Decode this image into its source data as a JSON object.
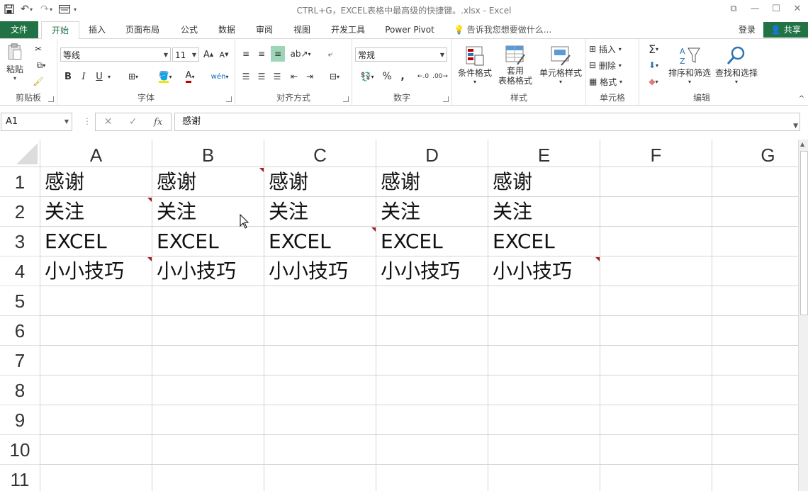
{
  "window": {
    "title": "CTRL+G，EXCEL表格中最高级的快捷键。.xlsx - Excel"
  },
  "tabs": {
    "file": "文件",
    "items": [
      "开始",
      "插入",
      "页面布局",
      "公式",
      "数据",
      "审阅",
      "视图",
      "开发工具",
      "Power Pivot"
    ],
    "tell_me": "告诉我您想要做什么...",
    "login": "登录",
    "share": "共享"
  },
  "ribbon": {
    "clipboard": {
      "label": "剪贴板",
      "paste": "粘贴"
    },
    "font": {
      "label": "字体",
      "name": "等线",
      "size": "11",
      "bold": "B",
      "italic": "I",
      "underline": "U",
      "font_color_letter": "A"
    },
    "alignment": {
      "label": "对齐方式"
    },
    "number": {
      "label": "数字",
      "format": "常规",
      "percent": "%",
      "comma": ","
    },
    "styles": {
      "label": "样式",
      "conditional": "条件格式",
      "table_1": "套用",
      "table_2": "表格格式",
      "cell_styles": "单元格样式"
    },
    "cells": {
      "label": "单元格",
      "insert": "插入",
      "delete": "删除",
      "format": "格式"
    },
    "editing": {
      "label": "编辑",
      "sort": "排序和筛选",
      "find": "查找和选择"
    }
  },
  "formula_bar": {
    "name_box": "A1",
    "fx": "fx",
    "value": "感谢"
  },
  "sheet": {
    "columns": [
      "A",
      "B",
      "C",
      "D",
      "E",
      "F",
      "G"
    ],
    "rows": [
      "1",
      "2",
      "3",
      "4",
      "5",
      "6",
      "7",
      "8",
      "9",
      "10",
      "11"
    ],
    "cells": [
      [
        "感谢",
        "感谢",
        "感谢",
        "感谢",
        "感谢"
      ],
      [
        "关注",
        "关注",
        "关注",
        "关注",
        "关注"
      ],
      [
        "EXCEL",
        "EXCEL",
        "EXCEL",
        "EXCEL",
        "EXCEL"
      ],
      [
        "小小技巧",
        "小小技巧",
        "小小技巧",
        "小小技巧",
        "小小技巧"
      ]
    ]
  },
  "colors": {
    "accent": "#217346",
    "comment": "#a61b1b"
  }
}
